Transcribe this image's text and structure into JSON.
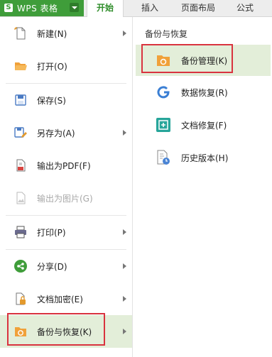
{
  "app": {
    "title": "WPS 表格",
    "logo": "S"
  },
  "tabs": [
    {
      "label": "开始"
    },
    {
      "label": "插入"
    },
    {
      "label": "页面布局"
    },
    {
      "label": "公式"
    }
  ],
  "menu": {
    "items": [
      {
        "label": "新建(N)",
        "icon": "new-file-icon"
      },
      {
        "label": "打开(O)",
        "icon": "folder-open-icon"
      },
      {
        "label": "保存(S)",
        "icon": "save-icon"
      },
      {
        "label": "另存为(A)",
        "icon": "save-as-icon"
      },
      {
        "label": "输出为PDF(F)",
        "icon": "pdf-icon"
      },
      {
        "label": "输出为图片(G)",
        "icon": "image-export-icon"
      },
      {
        "label": "打印(P)",
        "icon": "printer-icon"
      },
      {
        "label": "分享(D)",
        "icon": "share-icon"
      },
      {
        "label": "文档加密(E)",
        "icon": "lock-document-icon"
      },
      {
        "label": "备份与恢复(K)",
        "icon": "backup-icon"
      }
    ]
  },
  "submenu": {
    "title": "备份与恢复",
    "items": [
      {
        "label": "备份管理(K)",
        "icon": "backup-folder-icon"
      },
      {
        "label": "数据恢复(R)",
        "icon": "data-recovery-icon"
      },
      {
        "label": "文档修复(F)",
        "icon": "document-repair-icon"
      },
      {
        "label": "历史版本(H)",
        "icon": "history-version-icon"
      }
    ]
  },
  "colors": {
    "brand": "#3f9d3a",
    "selected": "#e3eed9",
    "highlight_box": "#d9333f"
  }
}
